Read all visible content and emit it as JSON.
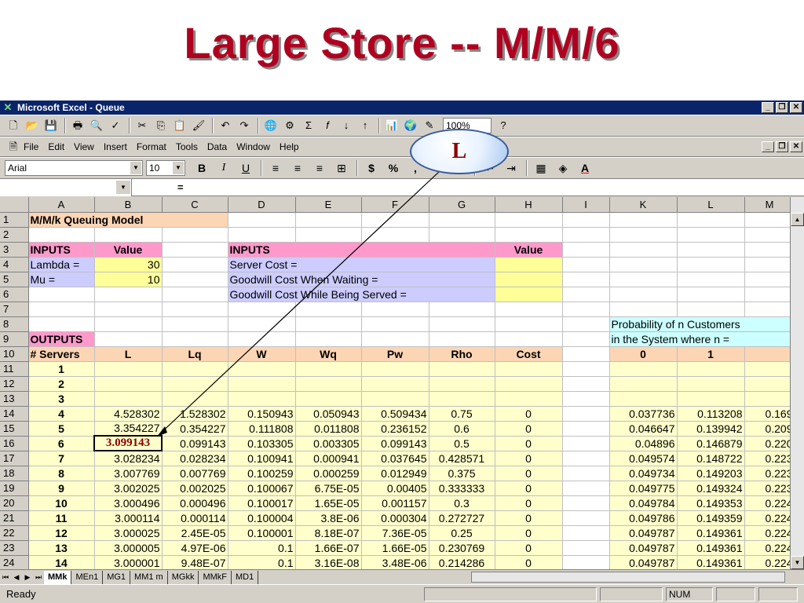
{
  "slide": {
    "title": "Large Store -- M/M/6"
  },
  "window": {
    "title": "Microsoft Excel - Queue"
  },
  "toolbar": {
    "zoom": "100%"
  },
  "menu": [
    "File",
    "Edit",
    "View",
    "Insert",
    "Format",
    "Tools",
    "Data",
    "Window",
    "Help"
  ],
  "format_toolbar": {
    "font": "Arial",
    "size": "10"
  },
  "formula_bar": {
    "equals": "="
  },
  "callout": {
    "label": "L"
  },
  "columns": [
    "A",
    "B",
    "C",
    "D",
    "E",
    "F",
    "G",
    "H",
    "I",
    "K",
    "L",
    "M"
  ],
  "cells": {
    "a1": "M/M/k Queuing Model",
    "a3": "INPUTS",
    "b3": "Value",
    "d3": "INPUTS",
    "h3": "Value",
    "a4": "Lambda =",
    "b4": "30",
    "d4": "Server Cost =",
    "a5": "Mu =",
    "b5": "10",
    "d5": "Goodwill Cost When Waiting =",
    "d6": "Goodwill Cost While Being Served =",
    "k8": "Probability of n Customers",
    "a9": "OUTPUTS",
    "k9": "in the System where n =",
    "headers": [
      "# Servers",
      "L",
      "Lq",
      "W",
      "Wq",
      "Pw",
      "Rho",
      "Cost"
    ],
    "k10": "0",
    "l10": "1"
  },
  "servers_rows": [
    {
      "row": "11",
      "k": "1"
    },
    {
      "row": "12",
      "k": "2"
    },
    {
      "row": "13",
      "k": "3"
    }
  ],
  "data_rows": [
    {
      "row": "14",
      "k": "4",
      "L": "4.528302",
      "Lq": "1.528302",
      "W": "0.150943",
      "Wq": "0.050943",
      "Pw": "0.509434",
      "Rho": "0.75",
      "Cost": "0",
      "p0": "0.037736",
      "p1": "0.113208",
      "p2": "0.169"
    },
    {
      "row": "15",
      "k": "5",
      "L": "3.354227",
      "Lq": "0.354227",
      "W": "0.111808",
      "Wq": "0.011808",
      "Pw": "0.236152",
      "Rho": "0.6",
      "Cost": "0",
      "p0": "0.046647",
      "p1": "0.139942",
      "p2": "0.209"
    },
    {
      "row": "16",
      "k": "6",
      "L": "3.099143",
      "Lq": "0.099143",
      "W": "0.103305",
      "Wq": "0.003305",
      "Pw": "0.099143",
      "Rho": "0.5",
      "Cost": "0",
      "p0": "0.04896",
      "p1": "0.146879",
      "p2": "0.220"
    },
    {
      "row": "17",
      "k": "7",
      "L": "3.028234",
      "Lq": "0.028234",
      "W": "0.100941",
      "Wq": "0.000941",
      "Pw": "0.037645",
      "Rho": "0.428571",
      "Cost": "0",
      "p0": "0.049574",
      "p1": "0.148722",
      "p2": "0.223"
    },
    {
      "row": "18",
      "k": "8",
      "L": "3.007769",
      "Lq": "0.007769",
      "W": "0.100259",
      "Wq": "0.000259",
      "Pw": "0.012949",
      "Rho": "0.375",
      "Cost": "0",
      "p0": "0.049734",
      "p1": "0.149203",
      "p2": "0.223"
    },
    {
      "row": "19",
      "k": "9",
      "L": "3.002025",
      "Lq": "0.002025",
      "W": "0.100067",
      "Wq": "6.75E-05",
      "Pw": "0.00405",
      "Rho": "0.333333",
      "Cost": "0",
      "p0": "0.049775",
      "p1": "0.149324",
      "p2": "0.223"
    },
    {
      "row": "20",
      "k": "10",
      "L": "3.000496",
      "Lq": "0.000496",
      "W": "0.100017",
      "Wq": "1.65E-05",
      "Pw": "0.001157",
      "Rho": "0.3",
      "Cost": "0",
      "p0": "0.049784",
      "p1": "0.149353",
      "p2": "0.224"
    },
    {
      "row": "21",
      "k": "11",
      "L": "3.000114",
      "Lq": "0.000114",
      "W": "0.100004",
      "Wq": "3.8E-06",
      "Pw": "0.000304",
      "Rho": "0.272727",
      "Cost": "0",
      "p0": "0.049786",
      "p1": "0.149359",
      "p2": "0.224"
    },
    {
      "row": "22",
      "k": "12",
      "L": "3.000025",
      "Lq": "2.45E-05",
      "W": "0.100001",
      "Wq": "8.18E-07",
      "Pw": "7.36E-05",
      "Rho": "0.25",
      "Cost": "0",
      "p0": "0.049787",
      "p1": "0.149361",
      "p2": "0.224"
    },
    {
      "row": "23",
      "k": "13",
      "L": "3.000005",
      "Lq": "4.97E-06",
      "W": "0.1",
      "Wq": "1.66E-07",
      "Pw": "1.66E-05",
      "Rho": "0.230769",
      "Cost": "0",
      "p0": "0.049787",
      "p1": "0.149361",
      "p2": "0.224"
    },
    {
      "row": "24",
      "k": "14",
      "L": "3.000001",
      "Lq": "9.48E-07",
      "W": "0.1",
      "Wq": "3.16E-08",
      "Pw": "3.48E-06",
      "Rho": "0.214286",
      "Cost": "0",
      "p0": "0.049787",
      "p1": "0.149361",
      "p2": "0.224"
    }
  ],
  "sheet_tabs": [
    "MMk",
    "MEn1",
    "MG1",
    "MM1 m",
    "MGkk",
    "MMkF",
    "MD1"
  ],
  "status": {
    "ready": "Ready",
    "num": "NUM"
  },
  "colors": {
    "title": "#b00020",
    "titlebar": "#0a246a",
    "highlight": "#8b0000"
  }
}
